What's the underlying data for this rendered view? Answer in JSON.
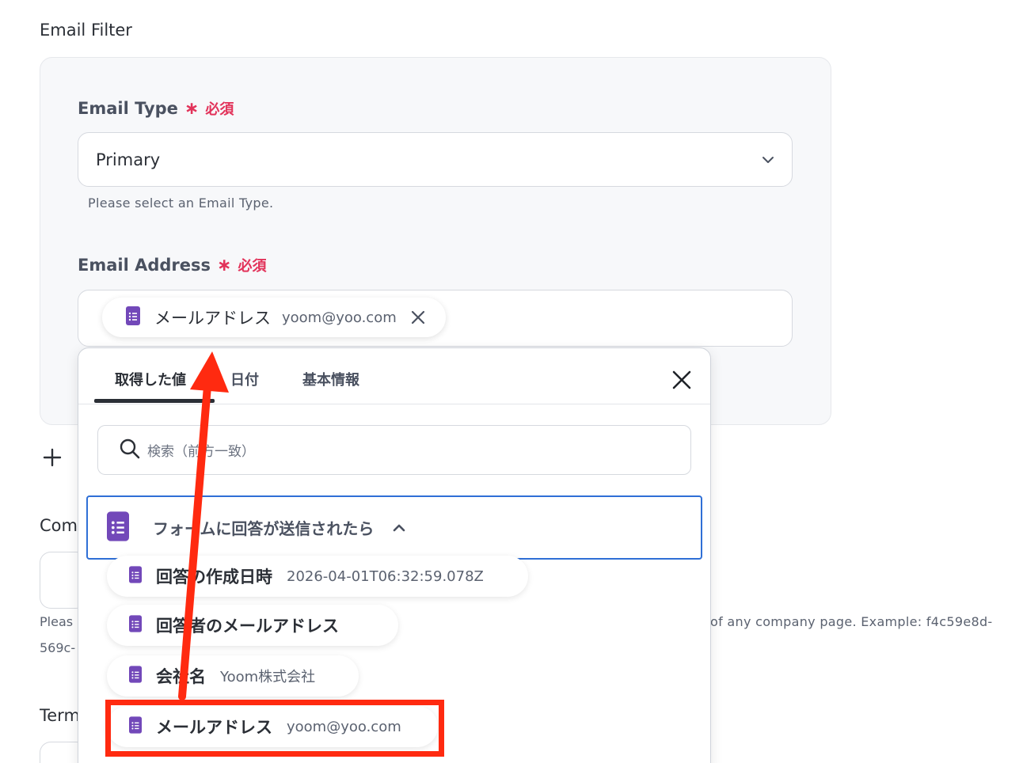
{
  "section": {
    "title": "Email Filter"
  },
  "email_type": {
    "label": "Email Type",
    "required_star": "∗",
    "required_text": "必須",
    "value": "Primary",
    "helper": "Please select an Email Type."
  },
  "email_address": {
    "label": "Email Address",
    "required_star": "∗",
    "required_text": "必須",
    "chip": {
      "name": "メールアドレス",
      "value": "yoom@yoo.com"
    }
  },
  "background": {
    "label_1": "Com",
    "help_1a": "Pleas",
    "help_1b": "of any company page. Example: f4c59e8d-",
    "help_1c": "569c-",
    "label_2": "Term"
  },
  "picker": {
    "tabs": [
      "取得した値",
      "日付",
      "基本情報"
    ],
    "active_tab": 0,
    "search_placeholder": "検索（前方一致）",
    "group_title": "フォームに回答が送信されたら",
    "items": [
      {
        "name": "回答の作成日時",
        "value": "2026-04-01T06:32:59.078Z"
      },
      {
        "name": "回答者のメールアドレス",
        "value": ""
      },
      {
        "name": "会社名",
        "value": "Yoom株式会社"
      },
      {
        "name": "メールアドレス",
        "value": "yoom@yoo.com"
      }
    ]
  },
  "colors": {
    "required": "#e2335a",
    "forms_icon": "#7248b9",
    "group_border": "#2f6fd6",
    "annotation": "#ff2a10"
  },
  "icons": {
    "forms": "google-forms-icon",
    "chevron_down": "chevron-down-icon",
    "chevron_up": "chevron-up-icon",
    "close": "close-icon",
    "search": "search-icon",
    "plus": "plus-icon"
  }
}
